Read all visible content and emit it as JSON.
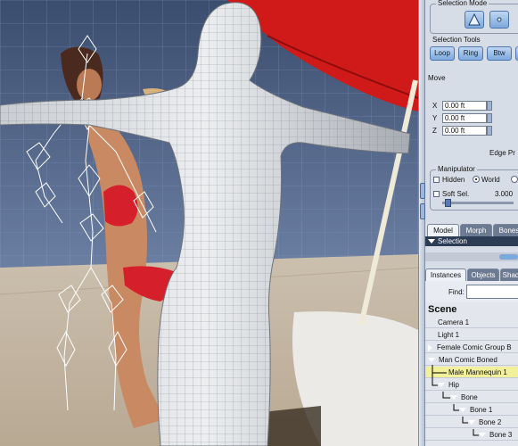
{
  "panel": {
    "selection_mode": {
      "title": "Selection Mode"
    },
    "selection_tools": {
      "label": "Selection Tools",
      "buttons": [
        "Loop",
        "Ring",
        "Btw"
      ]
    },
    "move": {
      "title": "Move",
      "x_label": "X",
      "x_value": "0.00 ft",
      "y_label": "Y",
      "y_value": "0.00 ft",
      "z_label": "Z",
      "z_value": "0.00 ft",
      "edge_label": "Edge Pr"
    },
    "manipulator": {
      "title": "Manipulator",
      "hidden_label": "Hidden",
      "world_label": "World",
      "soft_sel_label": "Soft Sel.",
      "soft_sel_value": "3.000"
    },
    "mode_tabs": [
      "Model",
      "Morph",
      "Bones"
    ],
    "selection_bar": "Selection",
    "list_tabs": [
      "Instances",
      "Objects",
      "Shad"
    ],
    "find_label": "Find:",
    "scene": {
      "title": "Scene",
      "items": [
        {
          "label": "Camera 1"
        },
        {
          "label": "Light 1"
        },
        {
          "label": "Female Comic Group B"
        },
        {
          "label": "Man Comic Boned"
        },
        {
          "label": "Male Mannequin 1"
        },
        {
          "label": "Hip"
        },
        {
          "label": "Bone"
        },
        {
          "label": "Bone 1"
        },
        {
          "label": "Bone 2"
        },
        {
          "label": "Bone 3"
        }
      ]
    }
  },
  "colors": {
    "panel_bg": "#d7dde6",
    "button_blue": "#7da8dc",
    "tree_bar": "#2d3c55",
    "highlight_row": "#f2f09a",
    "viewport_sky": "#4f6487",
    "umbrella_red": "#d01a1a"
  }
}
